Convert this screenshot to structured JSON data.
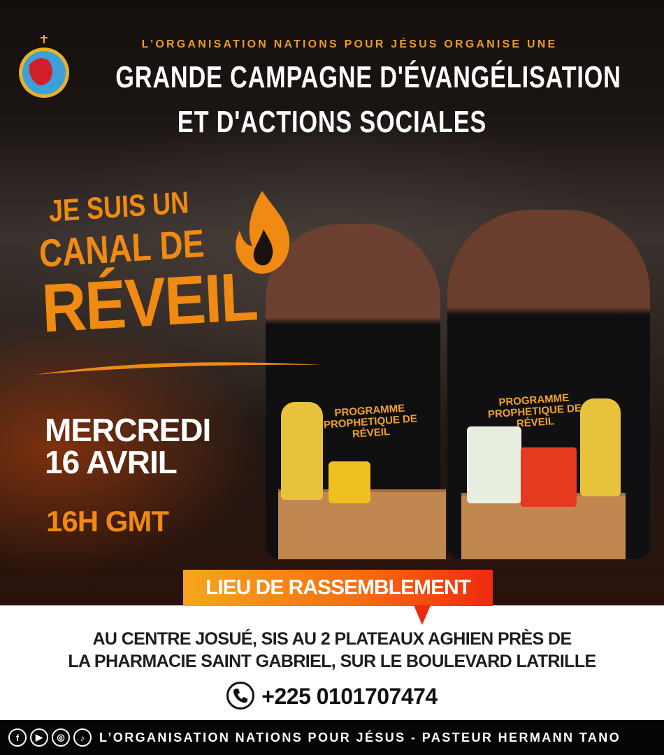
{
  "header": {
    "kicker": "L’ORGANISATION NATIONS POUR JÉSUS ORGANISE UNE",
    "title_line1": "GRANDE CAMPAGNE D'ÉVANGÉLISATION",
    "title_line2": "ET D'ACTIONS SOCIALES",
    "logo_icon": "nations-pour-jesus-logo"
  },
  "slogan": {
    "line1": "JE SUIS UN",
    "line2": "CANAL DE",
    "line3": "RÉVEIL",
    "icon": "flame-icon"
  },
  "event": {
    "day": "MERCREDI",
    "date": "16 AVRIL",
    "time": "16H GMT"
  },
  "shirt": {
    "text": "PROGRAMME PROPHETIQUE DE RÉVEIL"
  },
  "location": {
    "badge": "LIEU DE RASSEMBLEMENT",
    "address_line1": "AU CENTRE JOSUÉ, SIS AU 2 PLATEAUX AGHIEN PRÈS DE",
    "address_line2": "LA PHARMACIE SAINT GABRIEL, SUR LE BOULEVARD LATRILLE",
    "phone": "+225 0101707474"
  },
  "footer": {
    "social_icons": [
      "facebook-icon",
      "youtube-icon",
      "instagram-icon",
      "tiktok-icon"
    ],
    "text": "L’ORGANISATION NATIONS POUR JÉSUS - PASTEUR HERMANN TANO"
  },
  "colors": {
    "accent": "#f08a12",
    "badge_start": "#f7a51c",
    "badge_end": "#ee2a0e",
    "dark": "#120c0a"
  }
}
